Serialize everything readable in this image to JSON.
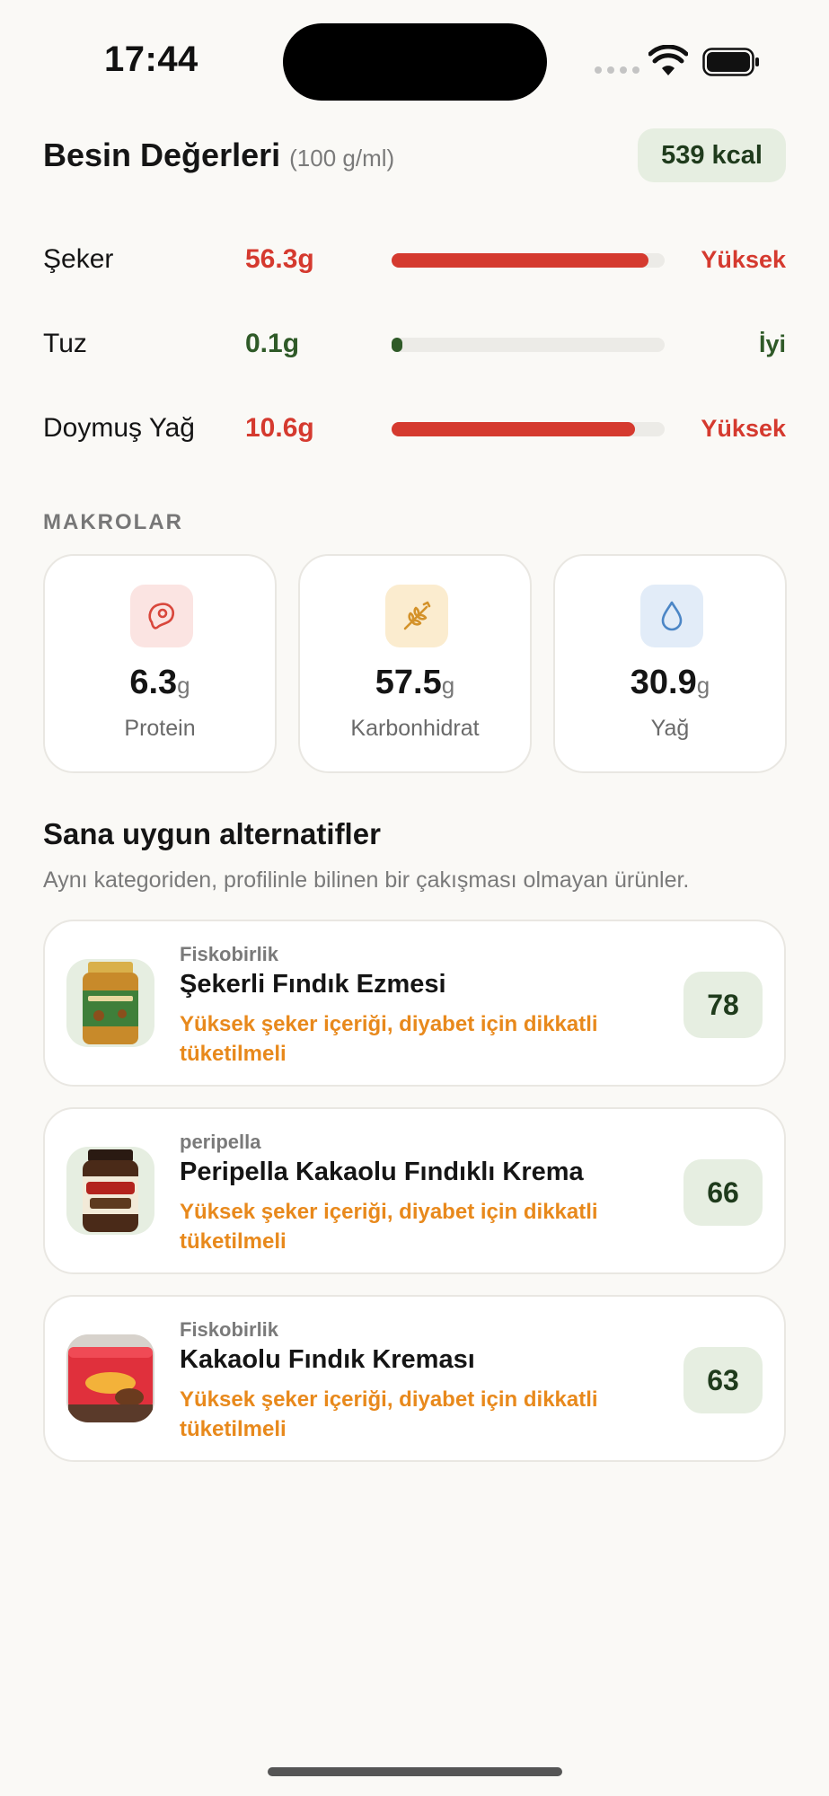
{
  "status_bar": {
    "time": "17:44"
  },
  "header": {
    "title": "Besin Değerleri",
    "unit_note": "(100 g/ml)",
    "calories": "539 kcal"
  },
  "nutrients": [
    {
      "name": "Şeker",
      "value": "56.3g",
      "level": "Yüksek",
      "fill_percent": 94,
      "color": "#d53a2f"
    },
    {
      "name": "Tuz",
      "value": "0.1g",
      "level": "İyi",
      "fill_percent": 4,
      "color": "#2f5a28"
    },
    {
      "name": "Doymuş Yağ",
      "value": "10.6g",
      "level": "Yüksek",
      "fill_percent": 89,
      "color": "#d53a2f"
    }
  ],
  "macros": {
    "section_label": "MAKROLAR",
    "unit": "g",
    "items": [
      {
        "value": "6.3",
        "label": "Protein",
        "icon": "meat-icon",
        "icon_bg": "#fbe4e2",
        "icon_color": "#d9473c"
      },
      {
        "value": "57.5",
        "label": "Karbonhidrat",
        "icon": "wheat-icon",
        "icon_bg": "#fbeccf",
        "icon_color": "#d4922a"
      },
      {
        "value": "30.9",
        "label": "Yağ",
        "icon": "drop-icon",
        "icon_bg": "#e2ecf8",
        "icon_color": "#4c86c6"
      }
    ]
  },
  "alternatives": {
    "title": "Sana uygun alternatifler",
    "subtitle": "Aynı kategoriden, profilinle bilinen bir çakışması olmayan ürünler.",
    "items": [
      {
        "brand": "Fiskobirlik",
        "name": "Şekerli Fındık Ezmesi",
        "warning": "Yüksek şeker içeriği, diyabet için dikkatli tüketilmeli",
        "score": "78",
        "image": "hazelnut-paste-jar-image"
      },
      {
        "brand": "peripella",
        "name": "Peripella Kakaolu Fındıklı Krema",
        "warning": "Yüksek şeker içeriği, diyabet için dikkatli tüketilmeli",
        "score": "66",
        "image": "cocoa-cream-jar-image"
      },
      {
        "brand": "Fiskobirlik",
        "name": "Kakaolu Fındık Kreması",
        "warning": "Yüksek şeker içeriği, diyabet için dikkatli tüketilmeli",
        "score": "63",
        "image": "cream-tub-image"
      }
    ]
  }
}
